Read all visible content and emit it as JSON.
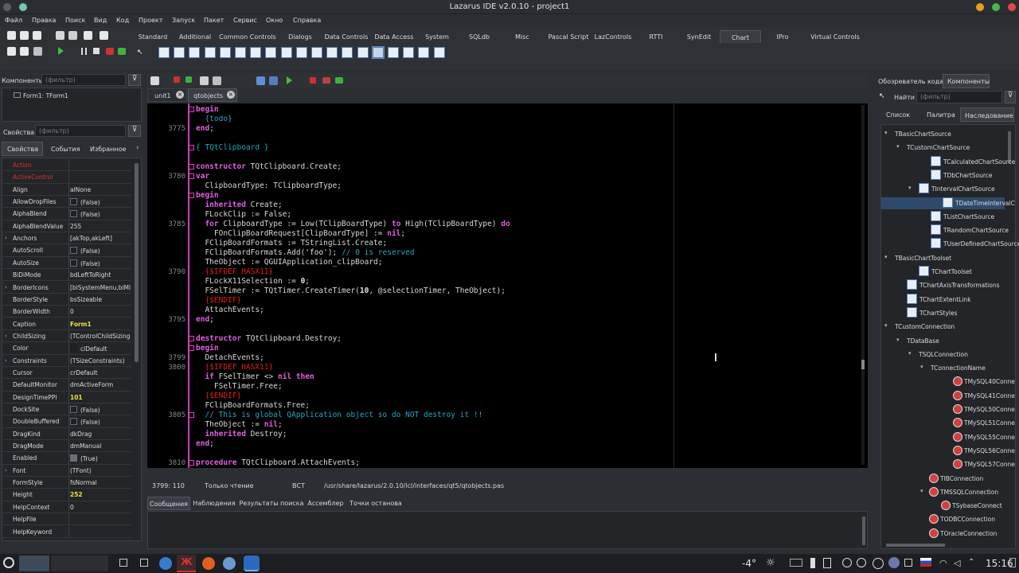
{
  "window": {
    "title": "Lazarus IDE v2.0.10 - project1"
  },
  "menu": [
    "Файл",
    "Правка",
    "Поиск",
    "Вид",
    "Код",
    "Проект",
    "Запуск",
    "Пакет",
    "Сервис",
    "Окно",
    "Справка"
  ],
  "palette_tabs": [
    "Standard",
    "Additional",
    "Common Controls",
    "Dialogs",
    "Data Controls",
    "Data Access",
    "System",
    "SQLdb",
    "Misc",
    "Pascal Script",
    "LazControls",
    "RTTI",
    "SynEdit",
    "Chart",
    "IPro",
    "Virtual Controls"
  ],
  "palette_active": "Chart",
  "components_panel": {
    "label": "Компоненты",
    "filter_placeholder": "(фильтр)",
    "tree_item": "Form1: TForm1"
  },
  "inspector": {
    "label": "Свойства",
    "filter_placeholder": "(фильтр)",
    "tabs": [
      "Свойства",
      "События",
      "Избранное"
    ],
    "rows": [
      {
        "k": "Action",
        "v": "",
        "kc": "#e03030"
      },
      {
        "k": "ActiveControl",
        "v": "",
        "kc": "#e03030"
      },
      {
        "k": "Align",
        "v": "alNone"
      },
      {
        "k": "AllowDropFiles",
        "v": "(False)",
        "chk": true
      },
      {
        "k": "AlphaBlend",
        "v": "(False)",
        "chk": true
      },
      {
        "k": "AlphaBlendValue",
        "v": "255"
      },
      {
        "k": "Anchors",
        "v": "[akTop,akLeft]",
        "exp": true
      },
      {
        "k": "AutoScroll",
        "v": "(False)",
        "chk": true
      },
      {
        "k": "AutoSize",
        "v": "(False)",
        "chk": true
      },
      {
        "k": "BiDiMode",
        "v": "bdLeftToRight"
      },
      {
        "k": "BorderIcons",
        "v": "[biSystemMenu,biMi",
        "exp": true
      },
      {
        "k": "BorderStyle",
        "v": "bsSizeable"
      },
      {
        "k": "BorderWidth",
        "v": "0"
      },
      {
        "k": "Caption",
        "v": "Form1",
        "vc": "#f0e040",
        "bold": true
      },
      {
        "k": "ChildSizing",
        "v": "(TControlChildSizing",
        "exp": true
      },
      {
        "k": "Color",
        "v": "clDefault",
        "sw": true
      },
      {
        "k": "Constraints",
        "v": "(TSizeConstraints)",
        "exp": true
      },
      {
        "k": "Cursor",
        "v": "crDefault"
      },
      {
        "k": "DefaultMonitor",
        "v": "dmActiveForm"
      },
      {
        "k": "DesignTimePPI",
        "v": "101",
        "vc": "#f0e040",
        "bold": true
      },
      {
        "k": "DockSite",
        "v": "(False)",
        "chk": true
      },
      {
        "k": "DoubleBuffered",
        "v": "(False)",
        "chk": true
      },
      {
        "k": "DragKind",
        "v": "dkDrag"
      },
      {
        "k": "DragMode",
        "v": "dmManual"
      },
      {
        "k": "Enabled",
        "v": "(True)",
        "chk": true,
        "on": true
      },
      {
        "k": "Font",
        "v": "(TFont)",
        "exp": true
      },
      {
        "k": "FormStyle",
        "v": "fsNormal"
      },
      {
        "k": "Height",
        "v": "252",
        "vc": "#f0e040",
        "bold": true
      },
      {
        "k": "HelpContext",
        "v": "0"
      },
      {
        "k": "HelpFile",
        "v": ""
      },
      {
        "k": "HelpKeyword",
        "v": ""
      }
    ]
  },
  "editor": {
    "tabs": [
      "unit1",
      "qtobjects"
    ],
    "active_tab": "qtobjects",
    "status": {
      "pos": "3799: 110",
      "mode": "Только чтение",
      "ins": "ВСТ",
      "file": "/usr/share/lazarus/2.0.10/lcl/interfaces/qt5/qtobjects.pas"
    },
    "line_numbers": [
      {
        "n": "3775",
        "row": 2
      },
      {
        "n": "3780",
        "row": 7
      },
      {
        "n": "3785",
        "row": 12
      },
      {
        "n": "3790",
        "row": 17
      },
      {
        "n": "3795",
        "row": 22
      },
      {
        "n": "3799",
        "row": 26
      },
      {
        "n": "3800",
        "row": 27
      },
      {
        "n": "3805",
        "row": 32
      },
      {
        "n": "3810",
        "row": 37
      }
    ]
  },
  "messages": {
    "tabs": [
      "Сообщения",
      "Наблюдения",
      "Результаты поиска",
      "Ассемблер",
      "Точки останова"
    ]
  },
  "right_panel": {
    "tabs": [
      "Обозреватель кода",
      "Компоненты"
    ],
    "filter_label": "Найти",
    "filter_placeholder": "(фильтр)",
    "subtabs": [
      "Список",
      "Палитра",
      "Наследование"
    ],
    "tree": [
      {
        "t": "TBasicChartSource",
        "lvl": 0,
        "a": "▾"
      },
      {
        "t": "TCustomChartSource",
        "lvl": 1,
        "a": "▾"
      },
      {
        "t": "TCalculatedChartSource",
        "lvl": 3,
        "i": true
      },
      {
        "t": "TDbChartSource",
        "lvl": 3,
        "i": true
      },
      {
        "t": "TIntervalChartSource",
        "lvl": 2,
        "i": true,
        "a": "▾"
      },
      {
        "t": "TDateTimeIntervalC",
        "lvl": 4,
        "i": true,
        "sel": true
      },
      {
        "t": "TListChartSource",
        "lvl": 3,
        "i": true
      },
      {
        "t": "TRandomChartSource",
        "lvl": 3,
        "i": true
      },
      {
        "t": "TUserDefinedChartSource",
        "lvl": 3,
        "i": true
      },
      {
        "t": "TBasicChartToolset",
        "lvl": 0,
        "a": "▾"
      },
      {
        "t": "TChartToolset",
        "lvl": 2,
        "i": true
      },
      {
        "t": "TChartAxisTransformations",
        "lvl": 1,
        "i": true
      },
      {
        "t": "TChartExtentLink",
        "lvl": 1,
        "i": true
      },
      {
        "t": "TChartStyles",
        "lvl": 1,
        "i": true
      },
      {
        "t": "TCustomConnection",
        "lvl": 0,
        "a": "▾"
      },
      {
        "t": "TDataBase",
        "lvl": 1,
        "a": "▾"
      },
      {
        "t": "TSQLConnection",
        "lvl": 2,
        "a": "▾"
      },
      {
        "t": "TConnectionName",
        "lvl": 3,
        "a": "▾"
      },
      {
        "t": "TMySQL40Conne",
        "lvl": 5,
        "db": true
      },
      {
        "t": "TMySQL41Conne",
        "lvl": 5,
        "db": true
      },
      {
        "t": "TMySQL50Conne",
        "lvl": 5,
        "db": true
      },
      {
        "t": "TMySQL51Conne",
        "lvl": 5,
        "db": true
      },
      {
        "t": "TMySQL55Conne",
        "lvl": 5,
        "db": true
      },
      {
        "t": "TMySQL56Conne",
        "lvl": 5,
        "db": true
      },
      {
        "t": "TMySQL57Conne",
        "lvl": 5,
        "db": true
      },
      {
        "t": "TIBConnection",
        "lvl": 3,
        "db": true
      },
      {
        "t": "TMSSQLConnection",
        "lvl": 3,
        "db": true,
        "a": "▾"
      },
      {
        "t": "TSybaseConnect",
        "lvl": 4,
        "db": true
      },
      {
        "t": "TODBCConnection",
        "lvl": 3,
        "db": true
      },
      {
        "t": "TOracleConnection",
        "lvl": 3,
        "db": true
      }
    ]
  },
  "taskbar": {
    "temp": "-4°",
    "time": "15:16"
  }
}
